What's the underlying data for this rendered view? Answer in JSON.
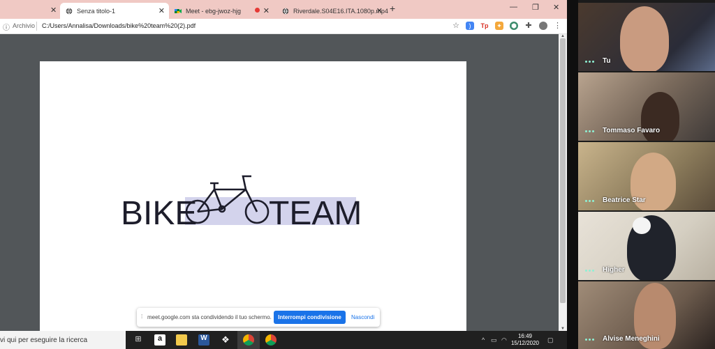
{
  "browser": {
    "tabs": [
      {
        "label": "Senza titolo-1",
        "active": true,
        "icon": "globe-icon"
      },
      {
        "label": "Meet - ebg-jwoz-hjg",
        "active": false,
        "icon": "meet-icon"
      },
      {
        "label": "Riverdale.S04E16.ITA.1080p.mp4",
        "active": false,
        "icon": "globe-icon"
      }
    ],
    "address": {
      "label": "Archivio",
      "url": "C:/Users/Annalisa/Downloads/bike%20team%20(2).pdf"
    }
  },
  "document": {
    "logo_text_left": "BIKE",
    "logo_text_right": "TEAM"
  },
  "share_notice": {
    "text": "meet.google.com sta condividendo il tuo schermo.",
    "stop_label": "Interrompi condivisione",
    "hide_label": "Nascondi"
  },
  "taskbar": {
    "search_text": "vi qui per eseguire la ricerca",
    "time": "16:49",
    "date": "15/12/2020"
  },
  "participants": [
    {
      "name": "Tu"
    },
    {
      "name": "Tommaso Favaro"
    },
    {
      "name": "Beatrice Star"
    },
    {
      "name": "Higher"
    },
    {
      "name": "Alvise Meneghini"
    }
  ],
  "colors": {
    "tabbar": "#f0c9c4",
    "viewer": "#525659",
    "accent": "#1a73e8",
    "logo_highlight": "#d3d3ec"
  }
}
